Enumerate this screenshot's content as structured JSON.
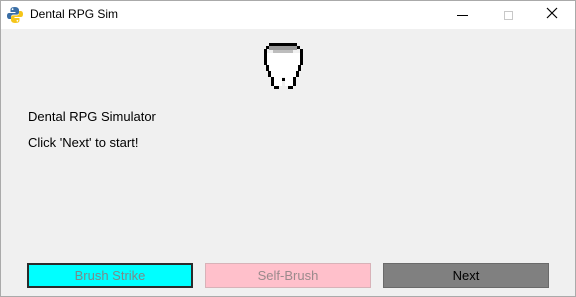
{
  "window": {
    "title": "Dental RPG Sim",
    "icon": "python-icon"
  },
  "controls": {
    "minimize": "minimize-icon",
    "maximize": "maximize-icon",
    "close": "close-icon"
  },
  "main": {
    "image": "tooth-icon",
    "title_label": "Dental RPG Simulator",
    "prompt_label": "Click 'Next' to start!"
  },
  "buttons": {
    "brush_strike": {
      "label": "Brush Strike",
      "color": "#00ffff",
      "state": "disabled"
    },
    "self_brush": {
      "label": "Self-Brush",
      "color": "#ffc0cb",
      "state": "disabled"
    },
    "next": {
      "label": "Next",
      "color": "#808080",
      "state": "enabled"
    }
  }
}
